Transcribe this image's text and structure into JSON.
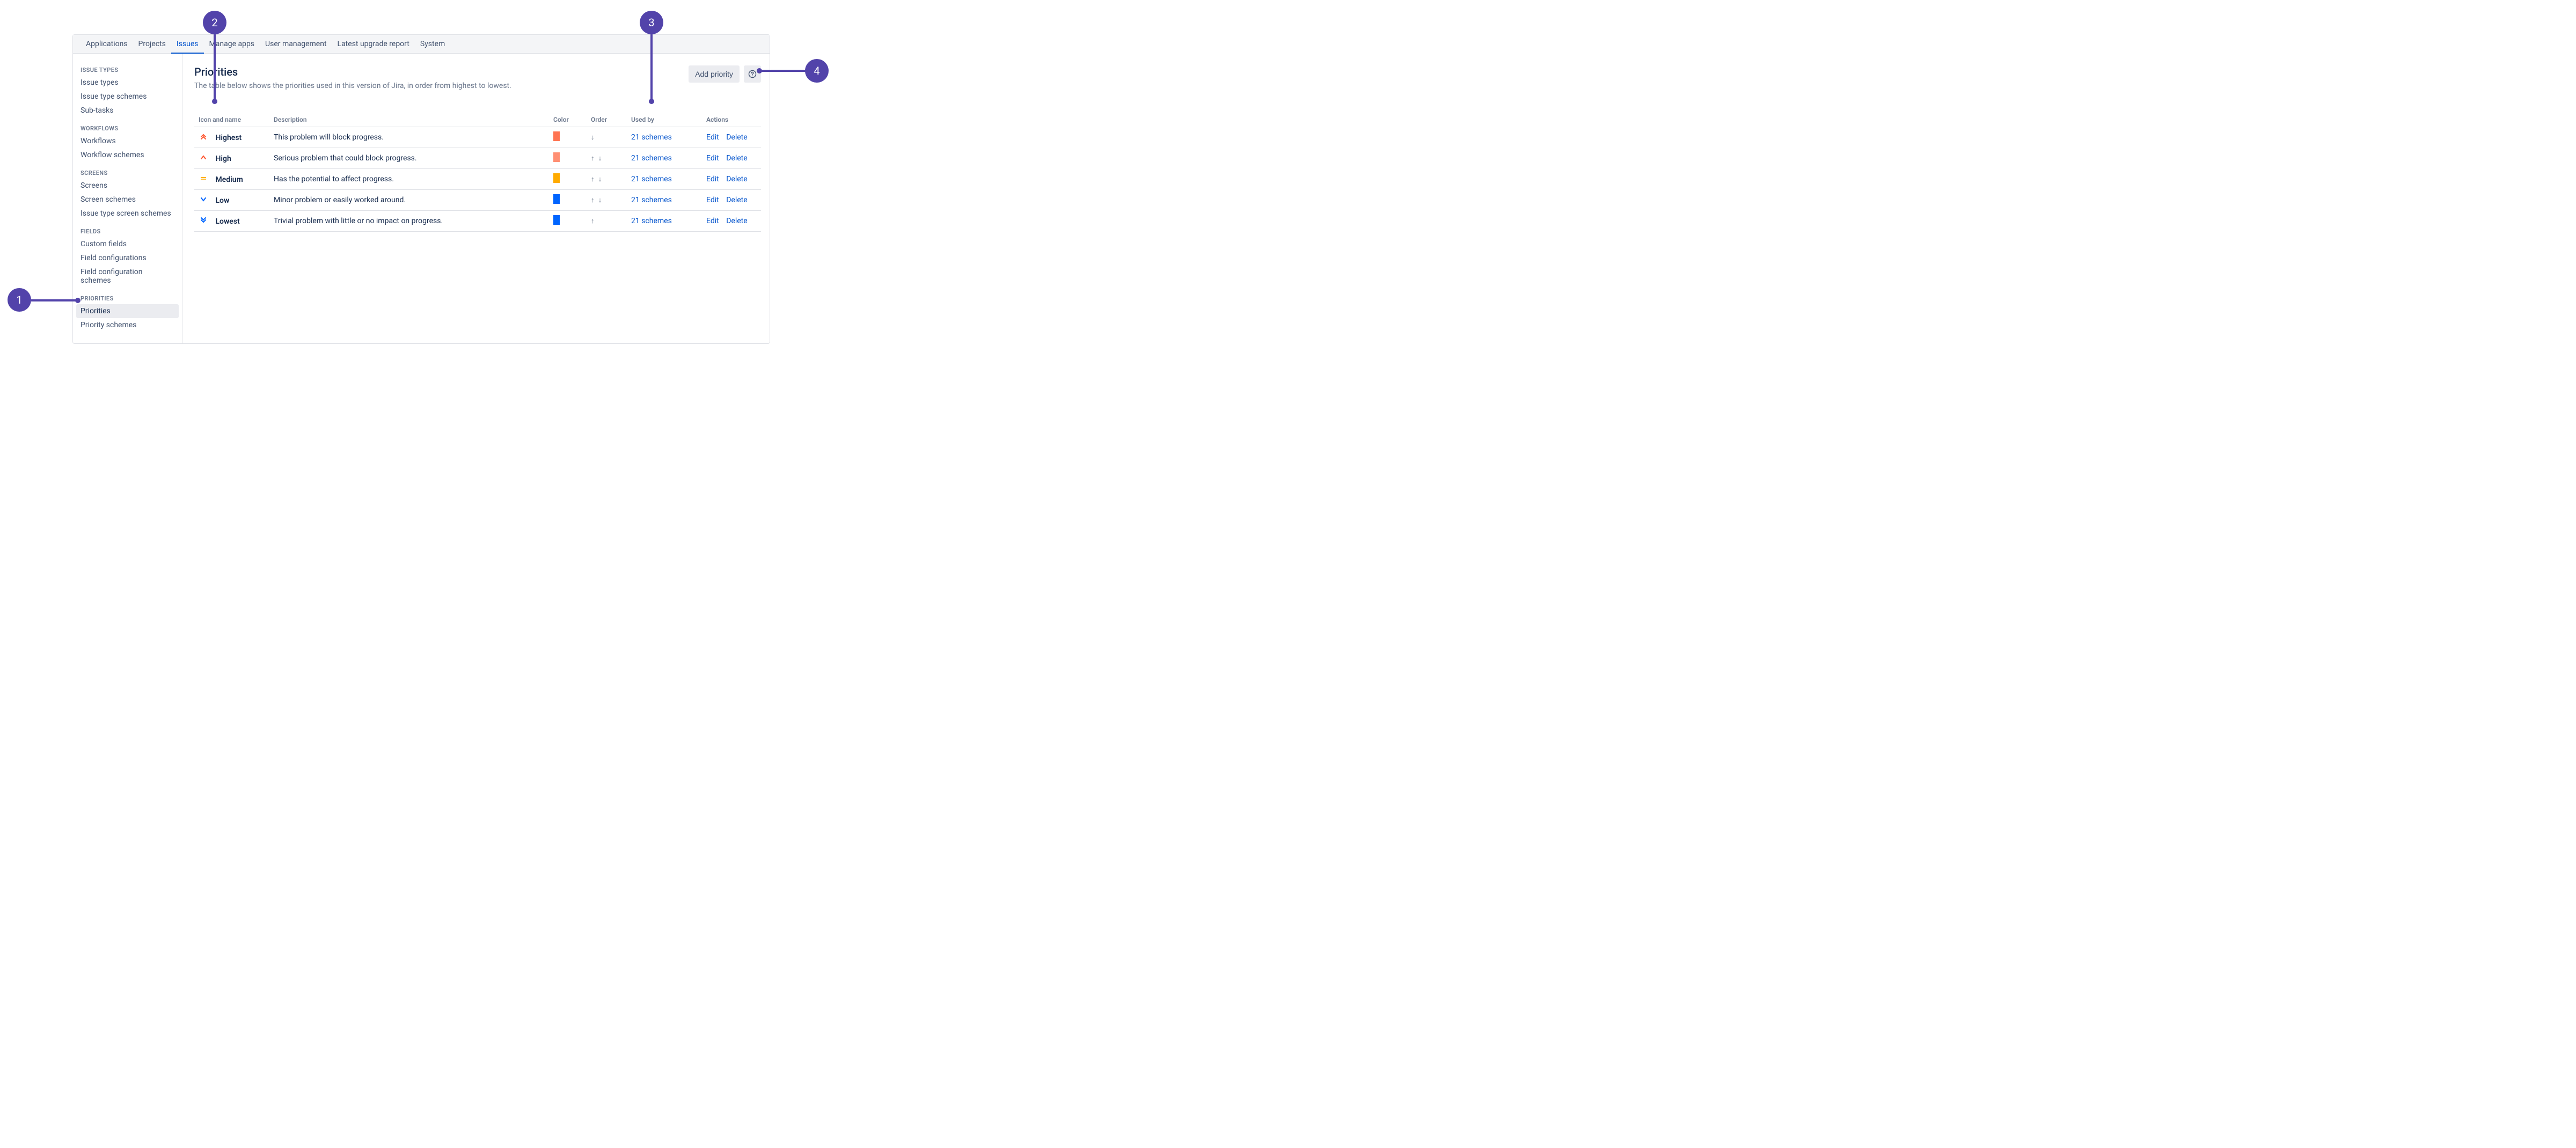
{
  "topnav": [
    {
      "label": "Applications"
    },
    {
      "label": "Projects"
    },
    {
      "label": "Issues",
      "active": true
    },
    {
      "label": "Manage apps"
    },
    {
      "label": "User management"
    },
    {
      "label": "Latest upgrade report"
    },
    {
      "label": "System"
    }
  ],
  "sidebar": [
    {
      "title": "ISSUE TYPES",
      "items": [
        "Issue types",
        "Issue type schemes",
        "Sub-tasks"
      ]
    },
    {
      "title": "WORKFLOWS",
      "items": [
        "Workflows",
        "Workflow schemes"
      ]
    },
    {
      "title": "SCREENS",
      "items": [
        "Screens",
        "Screen schemes",
        "Issue type screen schemes"
      ]
    },
    {
      "title": "FIELDS",
      "items": [
        "Custom fields",
        "Field configurations",
        "Field configuration schemes"
      ]
    },
    {
      "title": "PRIORITIES",
      "items": [
        "Priorities",
        "Priority schemes"
      ],
      "selected": "Priorities"
    }
  ],
  "page": {
    "title": "Priorities",
    "subtitle": "The table below shows the priorities used in this version of Jira, in order from highest to lowest.",
    "add_button": "Add priority"
  },
  "table": {
    "headers": {
      "icon_name": "Icon and name",
      "description": "Description",
      "color": "Color",
      "order": "Order",
      "used_by": "Used by",
      "actions": "Actions"
    },
    "rows": [
      {
        "icon": "highest",
        "name": "Highest",
        "description": "This problem will block progress.",
        "color": "#FF7452",
        "order": "down",
        "used_by": "21 schemes"
      },
      {
        "icon": "high",
        "name": "High",
        "description": "Serious problem that could block progress.",
        "color": "#FF8F73",
        "order": "updown",
        "used_by": "21 schemes"
      },
      {
        "icon": "medium",
        "name": "Medium",
        "description": "Has the potential to affect progress.",
        "color": "#FFAB00",
        "order": "updown",
        "used_by": "21 schemes"
      },
      {
        "icon": "low",
        "name": "Low",
        "description": "Minor problem or easily worked around.",
        "color": "#0065FF",
        "order": "updown",
        "used_by": "21 schemes"
      },
      {
        "icon": "lowest",
        "name": "Lowest",
        "description": "Trivial problem with little or no impact on progress.",
        "color": "#0065FF",
        "order": "up",
        "used_by": "21 schemes"
      }
    ],
    "actions": {
      "edit": "Edit",
      "delete": "Delete"
    }
  },
  "callouts": {
    "c1": "1",
    "c2": "2",
    "c3": "3",
    "c4": "4"
  }
}
